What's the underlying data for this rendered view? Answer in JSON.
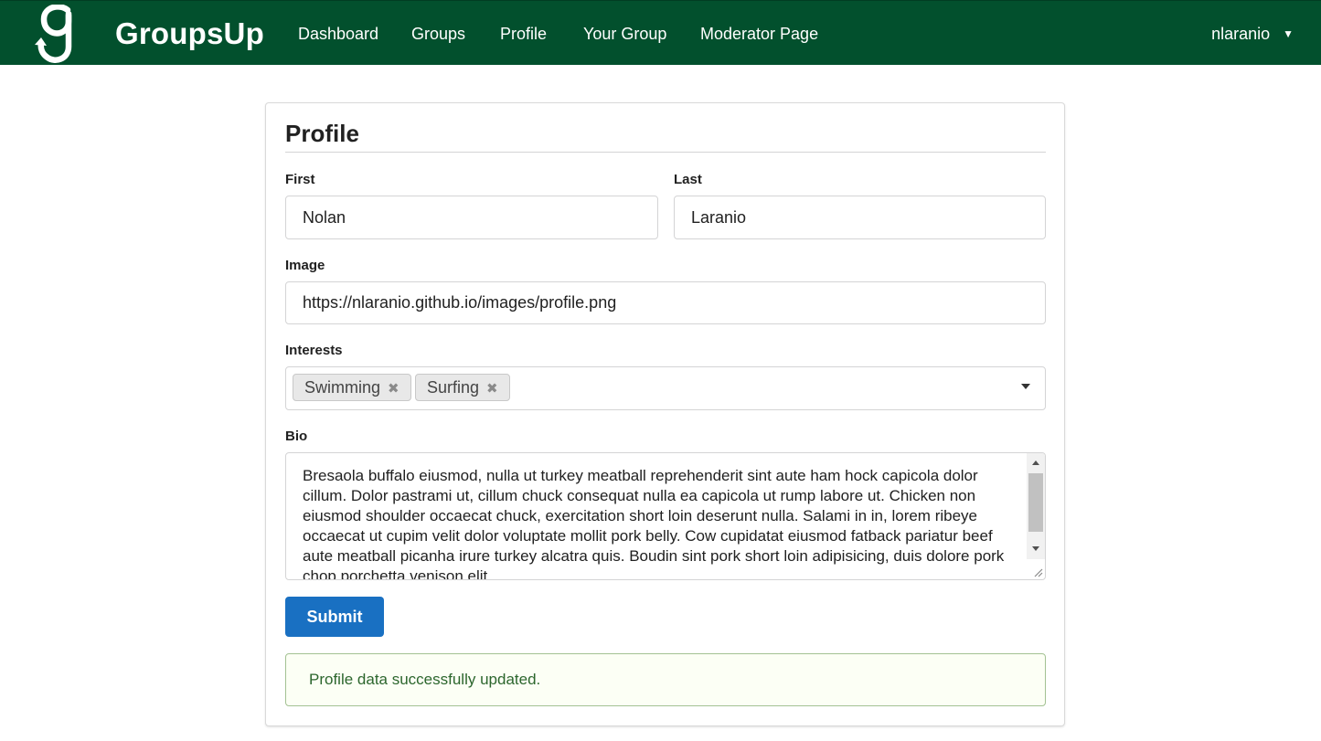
{
  "navbar": {
    "brand": "GroupsUp",
    "logo_icon": "groupsup-logo-icon",
    "items": [
      {
        "label": "Dashboard"
      },
      {
        "label": "Groups"
      },
      {
        "label": "Profile"
      },
      {
        "label": "Your Group"
      },
      {
        "label": "Moderator Page"
      }
    ],
    "user": "nlaranio",
    "user_caret_icon": "caret-down-icon",
    "color": "#02502d"
  },
  "profile": {
    "title": "Profile",
    "first_label": "First",
    "first_value": "Nolan",
    "last_label": "Last",
    "last_value": "Laranio",
    "image_label": "Image",
    "image_value": "https://nlaranio.github.io/images/profile.png",
    "interests_label": "Interests",
    "interests": [
      {
        "label": "Swimming"
      },
      {
        "label": "Surfing"
      }
    ],
    "bio_label": "Bio",
    "bio_value": "Bresaola buffalo eiusmod, nulla ut turkey meatball reprehenderit sint aute ham hock capicola dolor cillum. Dolor pastrami ut, cillum chuck consequat nulla ea capicola ut rump labore ut. Chicken non eiusmod shoulder occaecat chuck, exercitation short loin deserunt nulla. Salami in in, lorem ribeye occaecat ut cupim velit dolor voluptate mollit pork belly. Cow cupidatat eiusmod fatback pariatur beef aute meatball picanha irure turkey alcatra quis. Boudin sint pork short loin adipisicing, duis dolore pork chop porchetta venison elit.",
    "submit_label": "Submit",
    "submit_color": "#1970c2",
    "success_message": "Profile data successfully updated.",
    "success_color": "#2c662d"
  }
}
